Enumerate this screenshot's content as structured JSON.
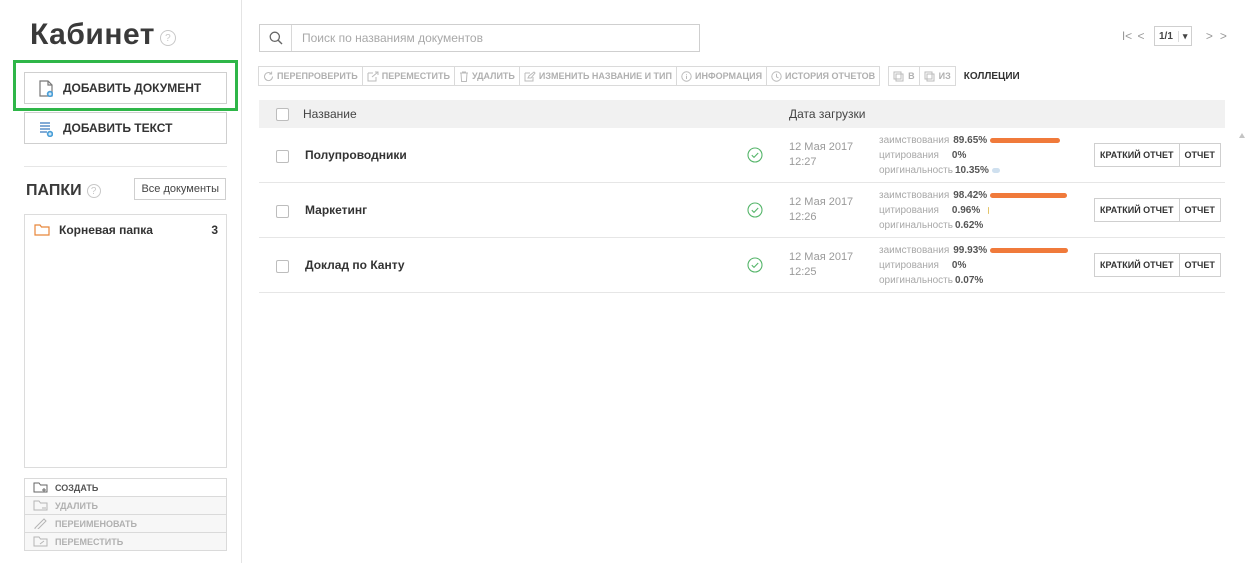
{
  "sidebar": {
    "title": "Кабинет",
    "add_document": "ДОБАВИТЬ ДОКУМЕНТ",
    "add_text": "ДОБАВИТЬ ТЕКСТ",
    "folders_label": "ПАПКИ",
    "all_documents": "Все документы",
    "folders": [
      {
        "name": "Корневая папка",
        "count": "3"
      }
    ],
    "actions": [
      {
        "label": "создать",
        "enabled": true,
        "icon": "folder-add-icon"
      },
      {
        "label": "удалить",
        "enabled": false,
        "icon": "folder-remove-icon"
      },
      {
        "label": "переименовать",
        "enabled": false,
        "icon": "pencil-icon"
      },
      {
        "label": "переместить",
        "enabled": false,
        "icon": "folder-move-icon"
      }
    ]
  },
  "search": {
    "placeholder": "Поиск по названиям документов",
    "value": ""
  },
  "pager": {
    "current": "1/1"
  },
  "toolbar": {
    "recheck": "ПЕРЕПРОВЕРИТЬ",
    "move": "ПЕРЕМЕСТИТЬ",
    "delete": "УДАЛИТЬ",
    "rename": "ИЗМЕНИТЬ НАЗВАНИЕ И ТИП",
    "info": "ИНФОРМАЦИЯ",
    "history": "ИСТОРИЯ ОТЧЕТОВ",
    "to": "В",
    "from": "ИЗ",
    "collections": "КОЛЛЕЦИИ"
  },
  "table": {
    "col_name": "Название",
    "col_date": "Дата загрузки",
    "stat_labels": {
      "borrow": "заимствования",
      "cite": "цитирования",
      "orig": "оригинальность"
    },
    "short_report": "КРАТКИЙ ОТЧЕТ",
    "report": "ОТЧЕТ",
    "rows": [
      {
        "name": "Полупроводники",
        "date": "12 Мая 2017",
        "time": "12:27",
        "borrow": "89.65%",
        "cite": "0%",
        "orig": "10.35%",
        "borrow_pct": 89.65,
        "cite_pct": 0,
        "orig_pct": 10.35
      },
      {
        "name": "Маркетинг",
        "date": "12 Мая 2017",
        "time": "12:26",
        "borrow": "98.42%",
        "cite": "0.96%",
        "orig": "0.62%",
        "borrow_pct": 98.42,
        "cite_pct": 0.96,
        "orig_pct": 0.62
      },
      {
        "name": "Доклад по Канту",
        "date": "12 Мая 2017",
        "time": "12:25",
        "borrow": "99.93%",
        "cite": "0%",
        "orig": "0.07%",
        "borrow_pct": 99.93,
        "cite_pct": 0,
        "orig_pct": 0.07
      }
    ]
  },
  "colors": {
    "highlight": "#2eb648",
    "borrow_bar": "#f07a3b",
    "orig_bar": "#cfe0ef",
    "ok": "#55b56a"
  }
}
